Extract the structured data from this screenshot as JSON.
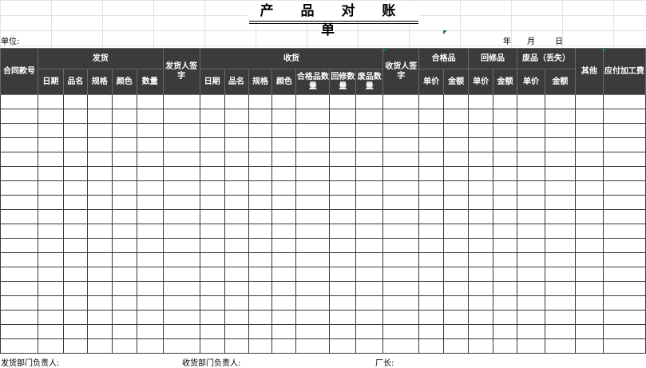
{
  "title": "产 品 对 账 单",
  "unit_label": "单位:",
  "date": {
    "year": "年",
    "month": "月",
    "day": "日"
  },
  "header_row1": {
    "contract_no": "合同款号",
    "shipment": "发货",
    "shipper_signature": "发货人签字",
    "receipt": "收货",
    "receiver_signature": "收货人签字",
    "qualified": "合格品",
    "repair": "回修品",
    "scrap": "废品（丢失）",
    "other": "其他",
    "payable_fee": "应付加工费"
  },
  "header_row2": {
    "ship_date": "日期",
    "ship_name": "品名",
    "ship_spec": "规格",
    "ship_color": "颜色",
    "ship_qty": "数量",
    "recv_date": "日期",
    "recv_name": "品名",
    "recv_spec": "规格",
    "recv_color": "颜色",
    "recv_qualified_qty": "合格品数量",
    "recv_repair_qty": "回修数量",
    "recv_scrap_qty": "废品数量",
    "qualified_price": "单价",
    "qualified_amount": "金额",
    "repair_price": "单价",
    "repair_amount": "金额",
    "scrap_price": "单价",
    "scrap_amount": "金额"
  },
  "footer": {
    "shipping_dept_head": "发货部门负责人:",
    "receiving_dept_head": "收货部门负责人:",
    "factory_head": "厂长:"
  }
}
